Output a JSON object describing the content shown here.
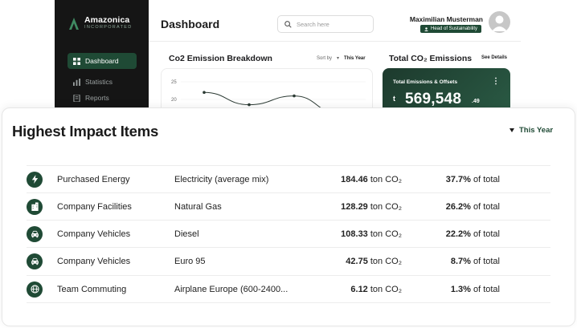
{
  "brand": {
    "name": "Amazonica",
    "sub": "INCORPORATED"
  },
  "sidebar": {
    "items": [
      {
        "label": "Dashboard",
        "icon": "grid-icon",
        "active": true
      },
      {
        "label": "Statistics",
        "icon": "bar-chart-icon"
      },
      {
        "label": "Reports",
        "icon": "document-icon"
      }
    ]
  },
  "header": {
    "title": "Dashboard",
    "search_placeholder": "Search here",
    "user_name": "Maximilian Musterman",
    "user_role": "Head of Sustainability"
  },
  "emission_chart": {
    "title": "Co2 Emission Breakdown",
    "sort_label": "Sort by",
    "sort_value": "This Year",
    "y_ticks": [
      "25",
      "20"
    ]
  },
  "chart_data": {
    "type": "line",
    "title": "Co2 Emission Breakdown",
    "y_ticks": [
      25,
      20
    ],
    "series": [
      {
        "values": [
          22,
          18.5,
          21,
          16
        ]
      }
    ]
  },
  "total": {
    "title": "Total CO₂ Emissions",
    "see_details": "See Details",
    "card_label": "Total Emissions & Offsets",
    "unit": "t",
    "value": "569,548",
    "decimal": ".49"
  },
  "impact": {
    "title": "Highest Impact Items",
    "filter": "This Year",
    "accent": "#1f4a35",
    "rows": [
      {
        "icon": "lightning-icon",
        "category": "Purchased Energy",
        "source": "Electricity (average mix)",
        "amount": "184.46",
        "unit": "ton CO₂",
        "percent": "37.7%",
        "percent_suffix": "of total"
      },
      {
        "icon": "building-icon",
        "category": "Company Facilities",
        "source": "Natural Gas",
        "amount": "128.29",
        "unit": "ton CO₂",
        "percent": "26.2%",
        "percent_suffix": "of total"
      },
      {
        "icon": "car-icon",
        "category": "Company Vehicles",
        "source": "Diesel",
        "amount": "108.33",
        "unit": "ton CO₂",
        "percent": "22.2%",
        "percent_suffix": "of total"
      },
      {
        "icon": "car-icon",
        "category": "Company Vehicles",
        "source": "Euro 95",
        "amount": "42.75",
        "unit": "ton CO₂",
        "percent": "8.7%",
        "percent_suffix": "of total"
      },
      {
        "icon": "globe-icon",
        "category": "Team Commuting",
        "source": "Airplane Europe (600-2400...",
        "amount": "6.12",
        "unit": "ton CO₂",
        "percent": "1.3%",
        "percent_suffix": "of total"
      }
    ]
  }
}
